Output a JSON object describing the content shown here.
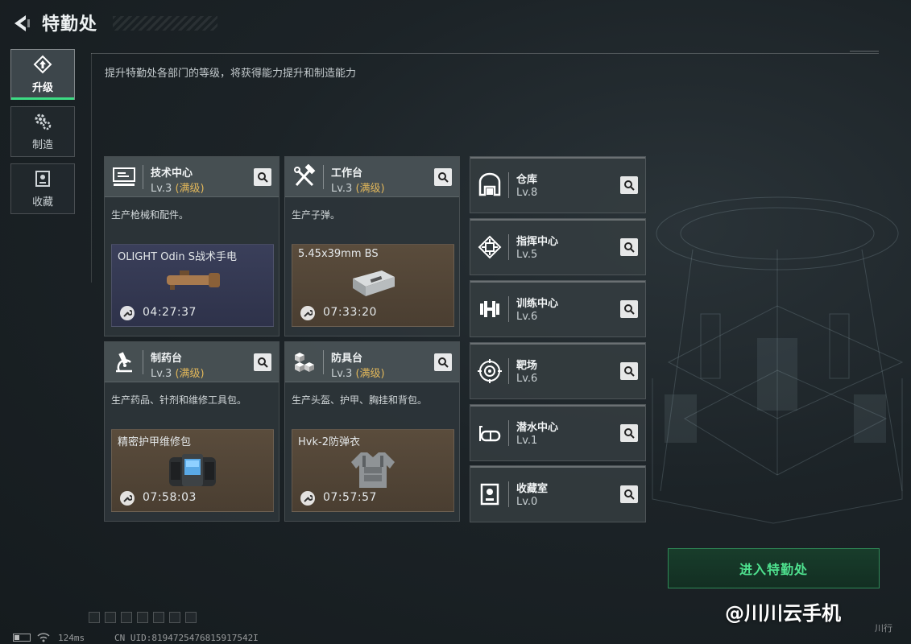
{
  "header": {
    "title": "特勤处"
  },
  "sidebar": {
    "tabs": [
      {
        "label": "升级",
        "icon": "upgrade-icon",
        "active": true
      },
      {
        "label": "制造",
        "icon": "gears-icon",
        "active": false
      },
      {
        "label": "收藏",
        "icon": "collection-icon",
        "active": false
      }
    ]
  },
  "subtitle": "提升特勤处各部门的等级，将获得能力提升和制造能力",
  "workshops": [
    {
      "name": "技术中心",
      "level": "Lv.3",
      "maxed": "(满级)",
      "icon": "monitor-icon",
      "desc": "生产枪械和配件。",
      "product": {
        "name": "OLIGHT Odin S战术手电",
        "time": "04:27:37",
        "bg": "blue",
        "icon": "flashlight-icon"
      }
    },
    {
      "name": "工作台",
      "level": "Lv.3",
      "maxed": "(满级)",
      "icon": "hammer-wrench-icon",
      "desc": "生产子弹。",
      "product": {
        "name": "5.45x39mm BS",
        "time": "07:33:20",
        "bg": "brown",
        "icon": "ammo-box-icon"
      }
    },
    {
      "name": "制药台",
      "level": "Lv.3",
      "maxed": "(满级)",
      "icon": "microscope-icon",
      "desc": "生产药品、针剂和维修工具包。",
      "product": {
        "name": "精密护甲维修包",
        "time": "07:58:03",
        "bg": "brown",
        "icon": "repair-kit-icon"
      }
    },
    {
      "name": "防具台",
      "level": "Lv.3",
      "maxed": "(满级)",
      "icon": "cubes-icon",
      "desc": "生产头盔、护甲、胸挂和背包。",
      "product": {
        "name": "Hvk-2防弹衣",
        "time": "07:57:57",
        "bg": "brown",
        "icon": "body-armor-icon"
      }
    }
  ],
  "facilities": [
    {
      "name": "仓库",
      "level": "Lv.8",
      "icon": "warehouse-icon"
    },
    {
      "name": "指挥中心",
      "level": "Lv.5",
      "icon": "chip-icon"
    },
    {
      "name": "训练中心",
      "level": "Lv.6",
      "icon": "dumbbell-icon"
    },
    {
      "name": "靶场",
      "level": "Lv.6",
      "icon": "target-icon"
    },
    {
      "name": "潜水中心",
      "level": "Lv.1",
      "icon": "diving-mask-icon"
    },
    {
      "name": "收藏室",
      "level": "Lv.0",
      "icon": "trophy-case-icon"
    }
  ],
  "actions": {
    "enter_label": "进入特勤处"
  },
  "status": {
    "ping": "124ms",
    "uid": "CN UID:8194725476815917542I"
  },
  "watermark": "@川川云手机",
  "corner_tag": "川行",
  "colors": {
    "accent_green": "#3ddc84",
    "maxed_gold": "#e0b65a",
    "button_green": "#4ee08e"
  }
}
